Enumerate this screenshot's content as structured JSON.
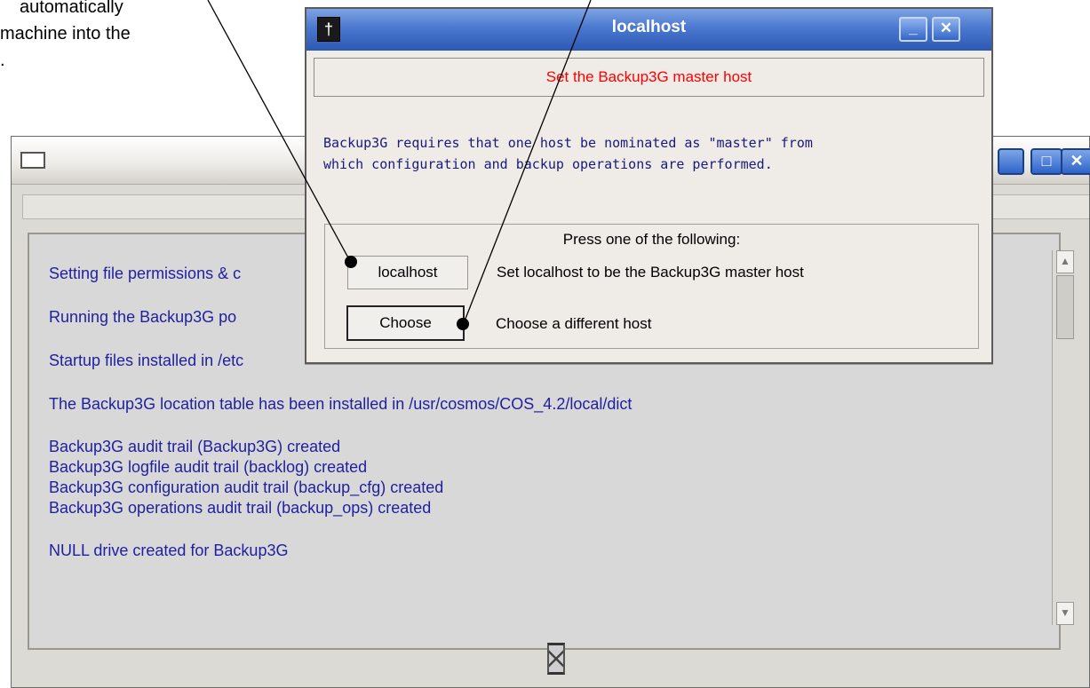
{
  "annotation": {
    "lines": [
      "automatically",
      "machine into the",
      "."
    ]
  },
  "background_window": {
    "log_lines": [
      "Setting file permissions & c",
      "Running the Backup3G po",
      "Startup files installed in /etc",
      "The Backup3G location table has been installed in /usr/cosmos/COS_4.2/local/dict",
      "Backup3G audit trail (Backup3G) created",
      "Backup3G logfile audit trail (backlog) created",
      "Backup3G configuration audit trail (backup_cfg) created",
      "Backup3G operations audit trail (backup_ops) created",
      "NULL drive created for Backup3G"
    ],
    "maximize_icon": "maximize-icon",
    "close_icon": "close-icon"
  },
  "dialog": {
    "title": "localhost",
    "header": "Set the Backup3G master host",
    "description_lines": [
      "Backup3G requires that one host be nominated as \"master\" from",
      "which configuration and backup operations are performed."
    ],
    "prompt": "Press one of the following:",
    "options": [
      {
        "button": "localhost",
        "label": "Set localhost to be the Backup3G master host"
      },
      {
        "button": "Choose",
        "label": "Choose a different host"
      }
    ],
    "minimize_symbol": "_",
    "close_symbol": "✕",
    "header_color": "#ff0000"
  }
}
